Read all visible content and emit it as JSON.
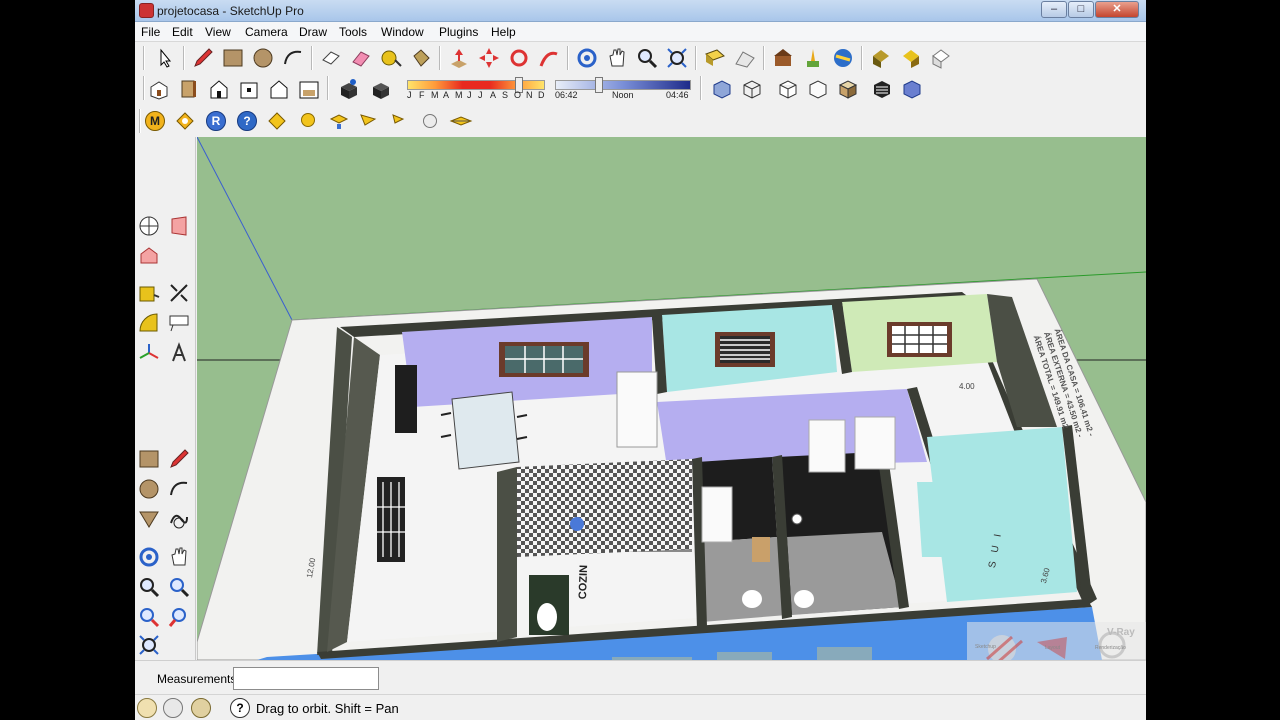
{
  "window": {
    "title": "projetocasa - SketchUp Pro"
  },
  "menu": [
    "File",
    "Edit",
    "View",
    "Camera",
    "Draw",
    "Tools",
    "Window",
    "Plugins",
    "Help"
  ],
  "shadow": {
    "months": [
      "J",
      "F",
      "M",
      "A",
      "M",
      "J",
      "J",
      "A",
      "S",
      "O",
      "N",
      "D"
    ],
    "time_start": "06:42",
    "time_mid": "Noon",
    "time_end": "04:46"
  },
  "plugins_row": {
    "m_label": "M",
    "r_label": "R",
    "q_label": "?"
  },
  "model": {
    "room_label_kitchen": "COZIN",
    "room_label_suite": "S U I",
    "dim_1": "4.00",
    "dim_2": "3.60",
    "dim_3": "12.00",
    "area_lines": [
      "ÁREA DA CASA = 106.41 m2 -",
      "ÁREA EXTERNA = 43.50 m2 -",
      "ÁREA TOTAL = 149.91 m2"
    ],
    "watermark_caption": [
      "Sketchup",
      "Layout",
      "Renderização"
    ],
    "watermark_brand": "V-Ray"
  },
  "status": {
    "measurements_label": "Measurements",
    "measurements_value": "",
    "hint": "Drag to orbit.  Shift = Pan"
  },
  "colors": {
    "ground": "#97be8e",
    "wall_purple": "#b5aef0",
    "wall_cyan": "#a8e6e4",
    "wall_green": "#cfeab7",
    "wall_exterior": "#4d90e8",
    "wall_dark": "#4b4f45",
    "floor": "#f4f4f4"
  }
}
